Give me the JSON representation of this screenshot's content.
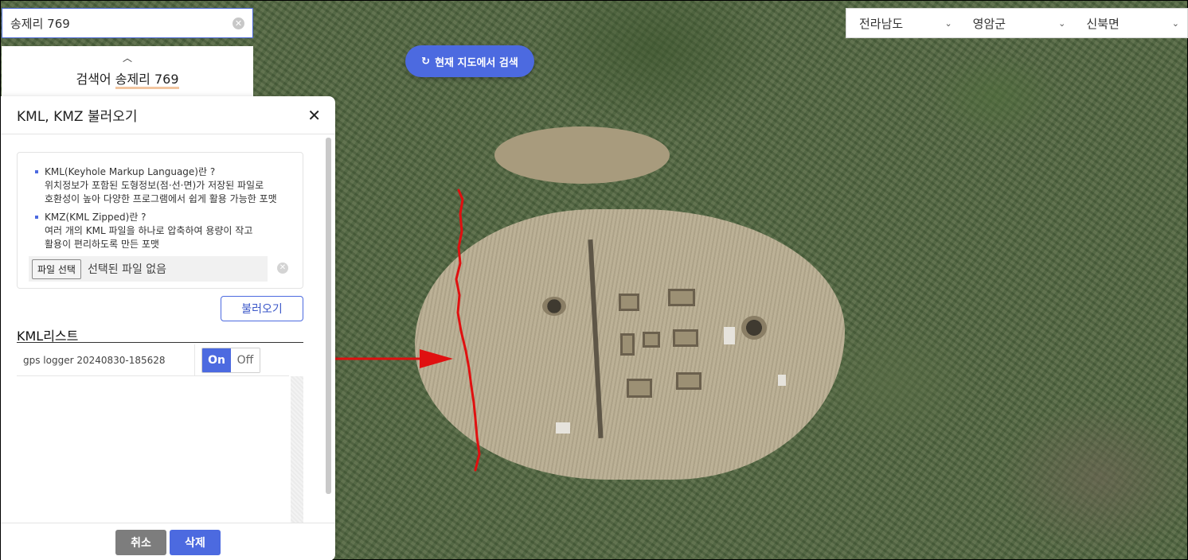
{
  "search": {
    "value": "송제리 769",
    "clear_icon": "clear-icon"
  },
  "search_result": {
    "prefix": "검색어",
    "keyword": "송제리 769"
  },
  "map": {
    "search_here_label": "현재 지도에서 검색",
    "refresh_icon": "refresh-icon"
  },
  "region": {
    "province": "전라남도",
    "county": "영암군",
    "town": "신북면"
  },
  "kml_panel": {
    "title": "KML, KMZ 불러오기",
    "info": [
      {
        "heading": "KML(Keyhole Markup Language)란 ?",
        "line1": "위치정보가 포함된 도형정보(점·선·면)가 저장된 파일로",
        "line2": "호환성이 높아 다양한 프로그램에서 쉽게 활용 가능한 포맷"
      },
      {
        "heading": "KMZ(KML Zipped)란 ?",
        "line1": "여러 개의 KML 파일을 하나로 압축하여 용량이 작고",
        "line2": "활용이 편리하도록 만든 포맷"
      }
    ],
    "file_button": "파일 선택",
    "file_status": "선택된 파일 없음",
    "load_button": "불러오기",
    "list_title": "KML리스트",
    "list": [
      {
        "name": "gps logger 20240830-185628",
        "on_label": "On",
        "off_label": "Off",
        "state": "on"
      }
    ],
    "cancel_button": "취소",
    "delete_button": "삭제"
  },
  "colors": {
    "accent": "#4c6ae0",
    "track": "#e01010",
    "arrow": "#e01010"
  }
}
